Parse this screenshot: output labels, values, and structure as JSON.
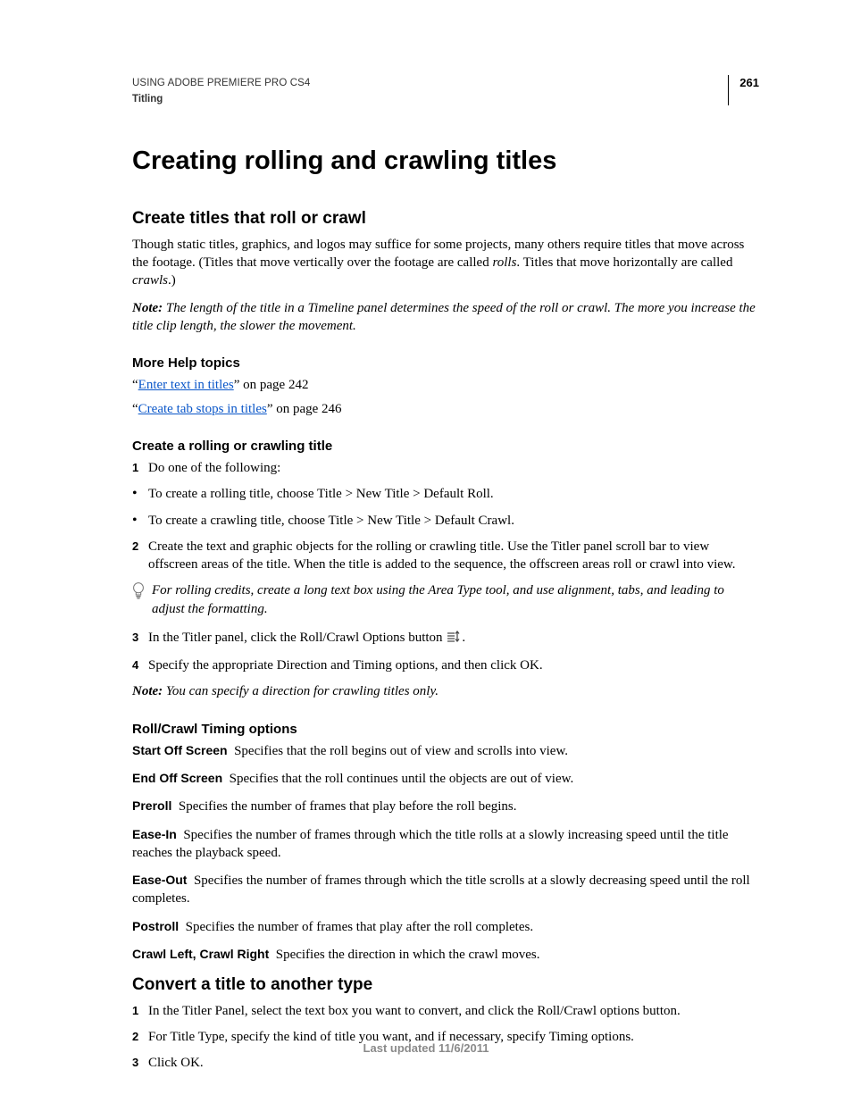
{
  "header": {
    "doc_title": "USING ADOBE PREMIERE PRO CS4",
    "doc_section": "Titling",
    "page_number": "261"
  },
  "chapter_title": "Creating rolling and crawling titles",
  "section1": {
    "title": "Create titles that roll or crawl",
    "para1_a": "Though static titles, graphics, and logos may suffice for some projects, many others require titles that move across the footage. (Titles that move vertically over the footage are called ",
    "para1_i1": "rolls",
    "para1_b": ". Titles that move horizontally are called ",
    "para1_i2": "crawls",
    "para1_c": ".)",
    "note_label": "Note: ",
    "note_body": "The length of the title in a Timeline panel determines the speed of the roll or crawl. The more you increase the title clip length, the slower the movement.",
    "more_help_title": "More Help topics",
    "help_q1a": "“",
    "help_link1": "Enter text in titles",
    "help_q1b": "” on page 242",
    "help_q2a": "“",
    "help_link2": "Create tab stops in titles",
    "help_q2b": "” on page 246",
    "sub1_title": "Create a rolling or crawling title",
    "step1_m": "1",
    "step1": "Do one of the following:",
    "bullet_m": "•",
    "bullet1": "To create a rolling title, choose Title > New Title > Default Roll.",
    "bullet2": "To create a crawling title, choose Title > New Title > Default Crawl.",
    "step2_m": "2",
    "step2": "Create the text and graphic objects for the rolling or crawling title. Use the Titler panel scroll bar to view offscreen areas of the title. When the title is added to the sequence, the offscreen areas roll or crawl into view.",
    "tip": "For rolling credits, create a long text box using the Area Type tool, and use alignment, tabs, and leading to adjust the formatting.",
    "step3_m": "3",
    "step3_a": "In the Titler panel, click the Roll/Crawl Options button ",
    "step3_b": ".",
    "step4_m": "4",
    "step4": "Specify the appropriate Direction and Timing options, and then click OK.",
    "note2_label": "Note: ",
    "note2_body": "You can specify a direction for crawling titles only.",
    "sub2_title": "Roll/Crawl Timing options",
    "defs": [
      {
        "term": "Start Off Screen",
        "body": "Specifies that the roll begins out of view and scrolls into view."
      },
      {
        "term": "End Off Screen",
        "body": "Specifies that the roll continues until the objects are out of view."
      },
      {
        "term": "Preroll",
        "body": "Specifies the number of frames that play before the roll begins."
      },
      {
        "term": "Ease-In",
        "body": "Specifies the number of frames through which the title rolls at a slowly increasing speed until the title reaches the playback speed."
      },
      {
        "term": "Ease-Out",
        "body": "Specifies the number of frames through which the title scrolls at a slowly decreasing speed until the roll completes."
      },
      {
        "term": "Postroll",
        "body": "Specifies the number of frames that play after the roll completes."
      },
      {
        "term": "Crawl Left, Crawl Right",
        "body": "Specifies the direction in which the crawl moves."
      }
    ]
  },
  "section2": {
    "title": "Convert a title to another type",
    "step1_m": "1",
    "step1": "In the Titler Panel, select the text box you want to convert, and click the Roll/Crawl options button.",
    "step2_m": "2",
    "step2": "For Title Type, specify the kind of title you want, and if necessary, specify Timing options.",
    "step3_m": "3",
    "step3": "Click OK."
  },
  "footer": "Last updated 11/6/2011"
}
